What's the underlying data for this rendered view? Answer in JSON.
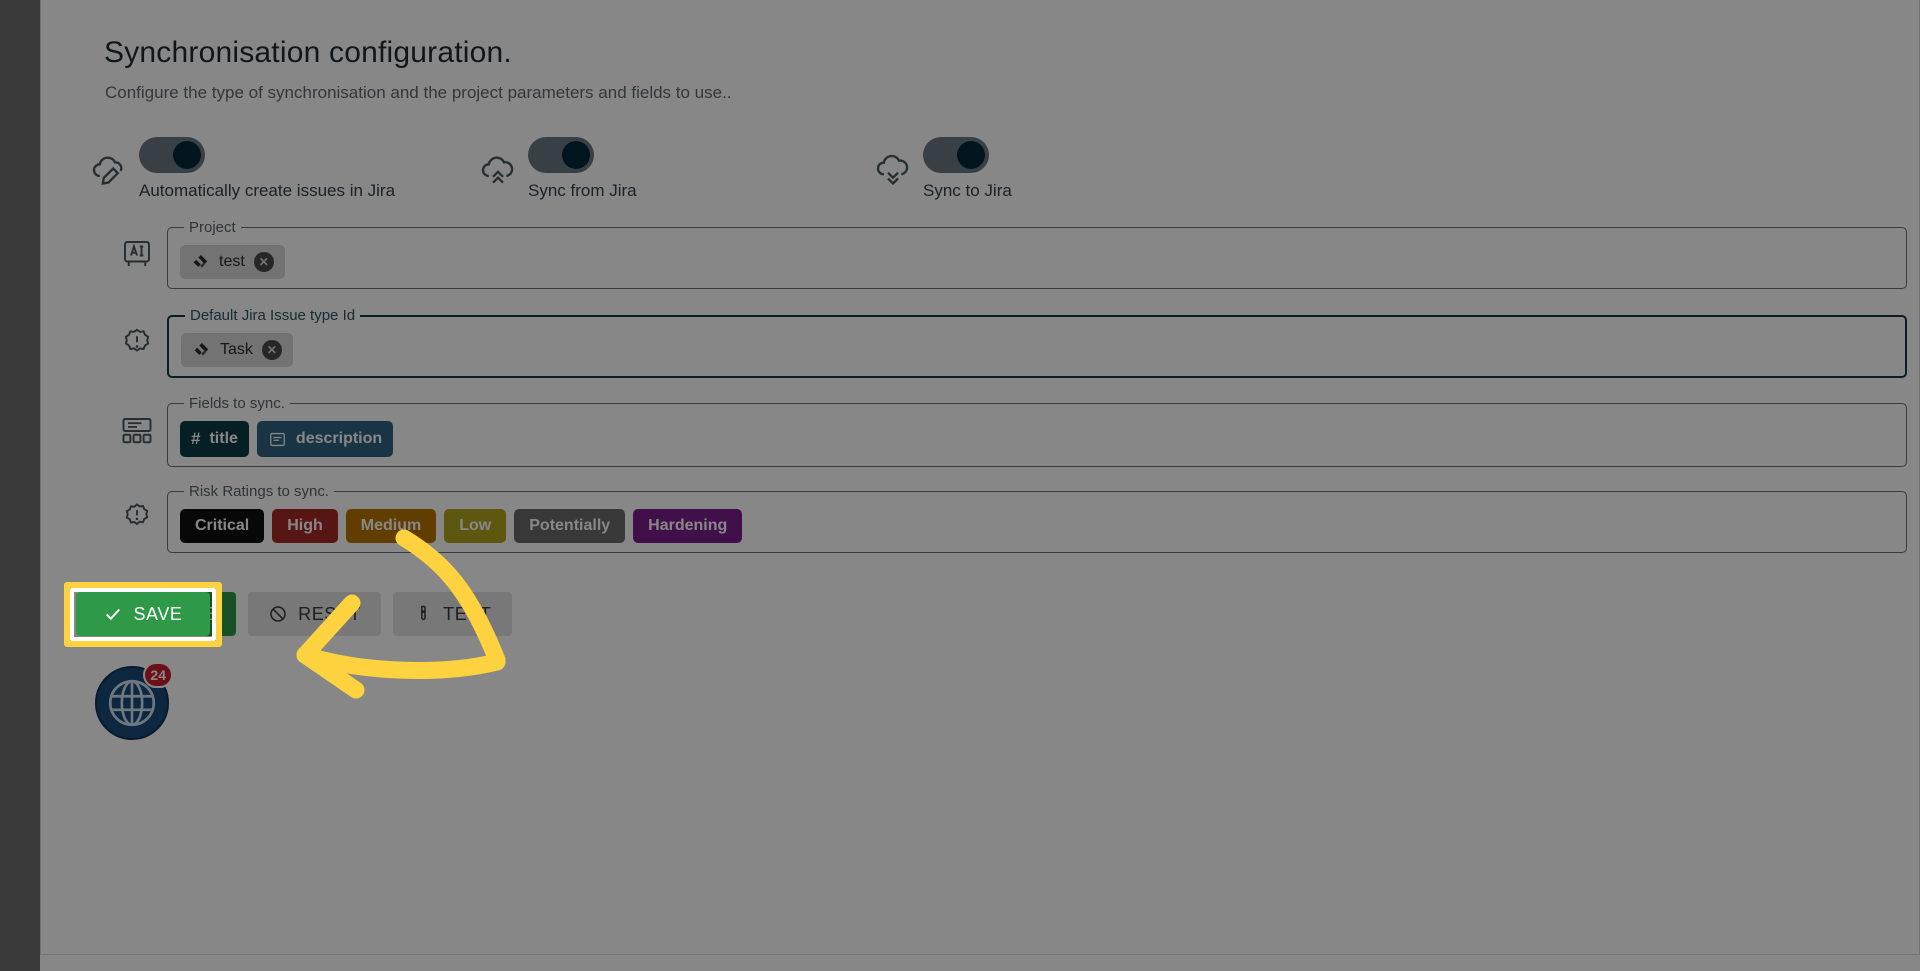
{
  "header": {
    "title": "Synchronisation configuration.",
    "subtitle": "Configure the type of synchronisation and the project parameters and fields to use.."
  },
  "toggles": [
    {
      "label": "Automatically create issues in Jira",
      "state": "on",
      "icon": "cloud-pencil-icon"
    },
    {
      "label": "Sync from Jira",
      "state": "on",
      "icon": "cloud-up-icon"
    },
    {
      "label": "Sync to Jira",
      "state": "on",
      "icon": "cloud-down-icon"
    }
  ],
  "fields": {
    "project": {
      "legend": "Project",
      "icon": "ruler-measure-icon",
      "focused": false,
      "chips": [
        {
          "label": "test",
          "icon": "jira-icon",
          "removable": true
        }
      ]
    },
    "issue_type": {
      "legend": "Default Jira Issue type Id",
      "icon": "settings-alert-icon",
      "focused": true,
      "chips": [
        {
          "label": "Task",
          "icon": "jira-icon",
          "removable": true
        }
      ]
    },
    "fields_to_sync": {
      "legend": "Fields to sync.",
      "icon": "form-layout-icon",
      "focused": false,
      "chips": [
        {
          "label": "title",
          "icon": "hash-icon",
          "color": "#0b3c44"
        },
        {
          "label": "description",
          "icon": "text-box-icon",
          "color": "#2f6383"
        }
      ]
    },
    "risk_ratings": {
      "legend": "Risk Ratings to sync.",
      "icon": "alert-badge-icon",
      "focused": false,
      "chips": [
        {
          "label": "Critical",
          "color": "#101010"
        },
        {
          "label": "High",
          "color": "#a52a27"
        },
        {
          "label": "Medium",
          "color": "#b87400"
        },
        {
          "label": "Low",
          "color": "#b0a41e"
        },
        {
          "label": "Potentially",
          "color": "#6b6b6b"
        },
        {
          "label": "Hardening",
          "color": "#7b1d8c"
        }
      ]
    }
  },
  "actions": {
    "save": {
      "label": "SAVE",
      "icon": "check-icon",
      "color": "#2e9a47"
    },
    "reset": {
      "label": "RESET",
      "icon": "ban-icon"
    },
    "test": {
      "label": "TEST",
      "icon": "test-tube-icon"
    }
  },
  "widget": {
    "count": "24",
    "icon": "globe-icon"
  },
  "annotation": {
    "highlight_color": "#ffd23f",
    "target": "save-button"
  }
}
